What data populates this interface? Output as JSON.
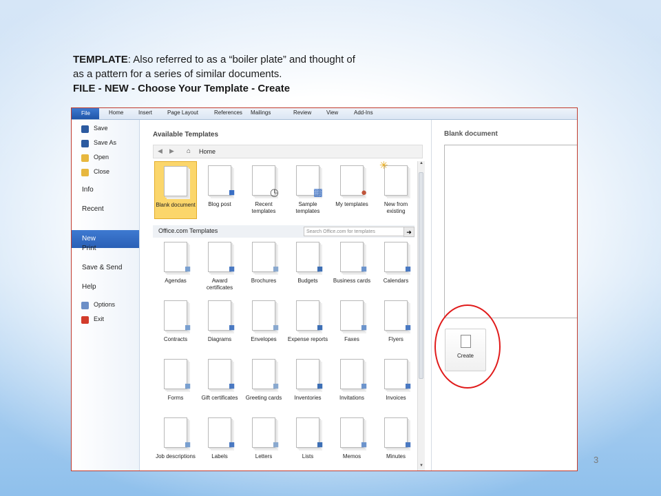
{
  "caption": {
    "line1_bold": "TEMPLATE",
    "line1_rest": ": Also referred to as a “boiler plate” and thought of",
    "line2": "as a pattern  for a series of similar documents.",
    "line3": "FILE - NEW - Choose Your Template - Create"
  },
  "slide_number": "3",
  "ribbon": {
    "tabs": [
      "File",
      "Home",
      "Insert",
      "Page Layout",
      "References",
      "Mailings",
      "Review",
      "View",
      "Add-Ins"
    ]
  },
  "backstage": {
    "items": [
      {
        "label": "Save",
        "icon": "save-icon",
        "color": "#2b5aa0"
      },
      {
        "label": "Save As",
        "icon": "save-as-icon",
        "color": "#2b5aa0"
      },
      {
        "label": "Open",
        "icon": "folder-open-icon",
        "color": "#e7b73e"
      },
      {
        "label": "Close",
        "icon": "folder-close-icon",
        "color": "#e7b73e"
      }
    ],
    "sections": [
      "Info",
      "Recent",
      "New",
      "Print",
      "Save & Send",
      "Help"
    ],
    "bottom_items": [
      {
        "label": "Options",
        "icon": "options-icon",
        "color": "#6c8fc7"
      },
      {
        "label": "Exit",
        "icon": "exit-icon",
        "color": "#d23b2b"
      }
    ],
    "selected": "New"
  },
  "templates": {
    "header": "Available Templates",
    "nav_location": "Home",
    "top_tiles": [
      {
        "label": "Blank document",
        "icon": "blank-document-icon"
      },
      {
        "label": "Blog post",
        "icon": "blog-post-icon"
      },
      {
        "label": "Recent templates",
        "icon": "clock-icon"
      },
      {
        "label": "Sample templates",
        "icon": "monitor-icon"
      },
      {
        "label": "My templates",
        "icon": "person-icon"
      },
      {
        "label": "New from existing",
        "icon": "new-from-existing-icon"
      }
    ],
    "office_header": "Office.com Templates",
    "search_placeholder": "Search Office.com for templates",
    "office_tiles": [
      {
        "label": "Agendas",
        "icon": "agendas-icon"
      },
      {
        "label": "Award certificates",
        "icon": "award-certificate-icon"
      },
      {
        "label": "Brochures",
        "icon": "brochures-icon"
      },
      {
        "label": "Budgets",
        "icon": "budgets-icon"
      },
      {
        "label": "Business cards",
        "icon": "business-cards-icon"
      },
      {
        "label": "Calendars",
        "icon": "calendar-icon"
      },
      {
        "label": "Contracts",
        "icon": "contracts-icon"
      },
      {
        "label": "Diagrams",
        "icon": "diagrams-icon"
      },
      {
        "label": "Envelopes",
        "icon": "envelope-icon"
      },
      {
        "label": "Expense reports",
        "icon": "expense-report-icon"
      },
      {
        "label": "Faxes",
        "icon": "fax-icon"
      },
      {
        "label": "Flyers",
        "icon": "flyers-icon"
      },
      {
        "label": "Forms",
        "icon": "forms-icon"
      },
      {
        "label": "Gift certificates",
        "icon": "gift-certificate-icon"
      },
      {
        "label": "Greeting cards",
        "icon": "greeting-cards-icon"
      },
      {
        "label": "Inventories",
        "icon": "inventories-icon"
      },
      {
        "label": "Invitations",
        "icon": "invitations-icon"
      },
      {
        "label": "Invoices",
        "icon": "invoices-icon"
      },
      {
        "label": "Job descriptions",
        "icon": "job-description-icon"
      },
      {
        "label": "Labels",
        "icon": "labels-icon"
      },
      {
        "label": "Letters",
        "icon": "letters-icon"
      },
      {
        "label": "Lists",
        "icon": "lists-icon"
      },
      {
        "label": "Memos",
        "icon": "memos-icon"
      },
      {
        "label": "Minutes",
        "icon": "minutes-icon"
      }
    ]
  },
  "right_pane": {
    "title": "Blank document",
    "create_label": "Create"
  },
  "colors": {
    "selection": "#fbd66b",
    "file_tab": "#2a60b6",
    "highlight_circle": "#e01b1b",
    "screenshot_border": "#c0392b"
  }
}
